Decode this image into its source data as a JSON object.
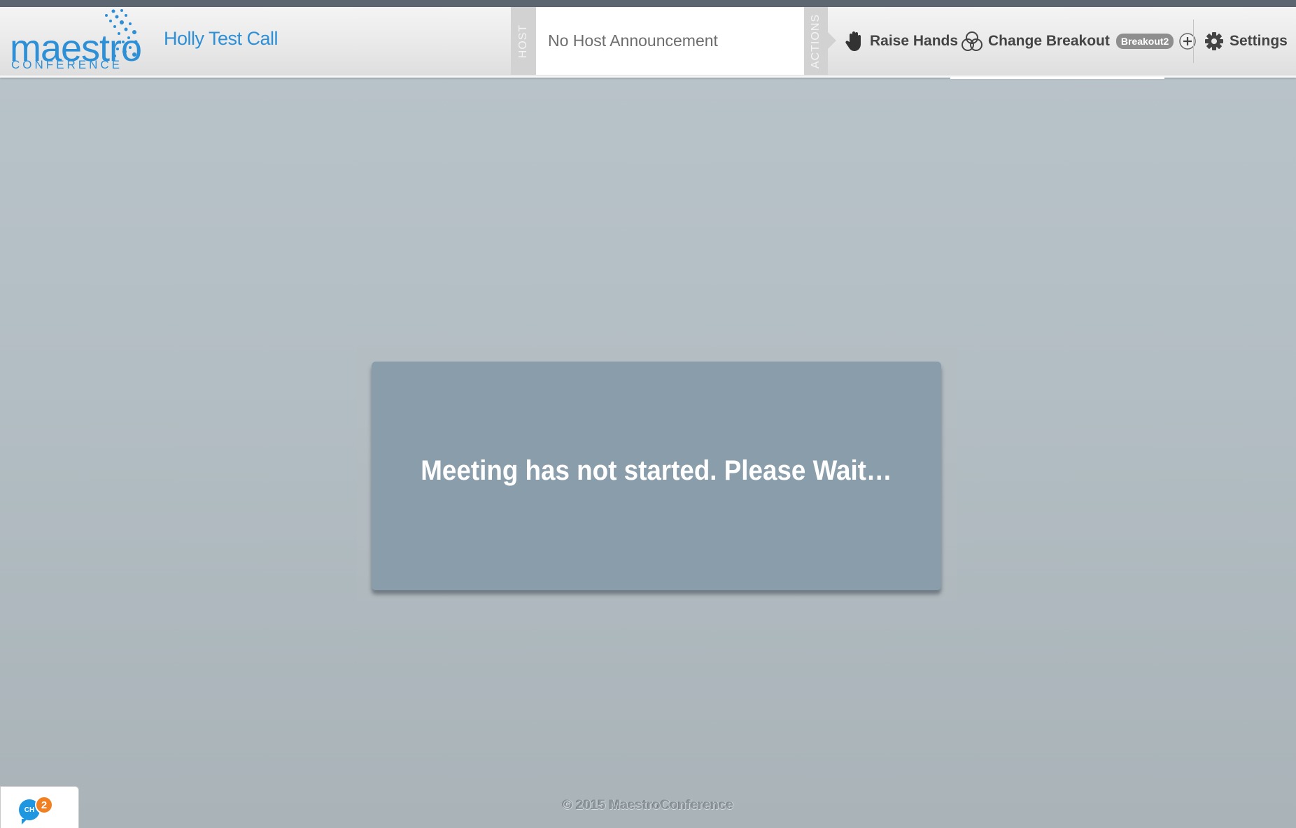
{
  "app": {
    "logo_word": "maestro",
    "logo_subtitle": "CONFERENCE",
    "call_title": "Holly Test Call",
    "brand_color": "#2d8fd6"
  },
  "header": {
    "host_label": "HOST",
    "announcement": "No Host Announcement",
    "actions_label": "ACTIONS",
    "raise_hands_label": "Raise Hands",
    "raise_hands_icon": "hand-icon",
    "change_breakout_label": "Change Breakout",
    "change_breakout_icon": "breakout-circles-icon",
    "breakout_badge": "Breakout2",
    "add_icon": "plus-circle-icon",
    "settings_label": "Settings",
    "settings_icon": "gear-icon"
  },
  "main": {
    "waiting_message": "Meeting has not started. Please Wait…",
    "waiting_box_color": "#8a9dab"
  },
  "footer": {
    "copyright": "© 2015 MaestroConference"
  },
  "chat": {
    "label": "CH",
    "unread_count": "2",
    "badge_color": "#f08022"
  }
}
